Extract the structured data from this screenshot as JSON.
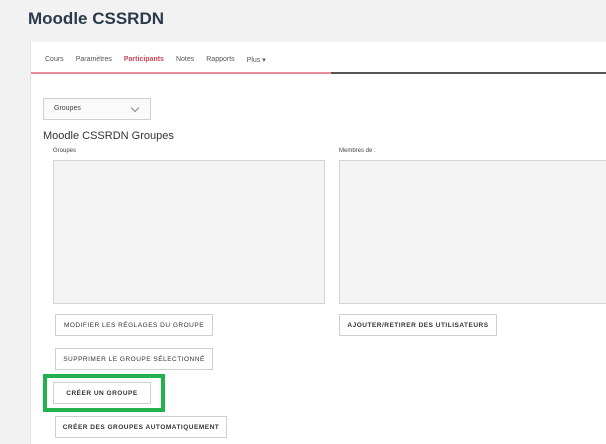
{
  "course": {
    "title": "Moodle CSSRDN"
  },
  "tabs": [
    {
      "label": "Cours"
    },
    {
      "label": "Paramètres"
    },
    {
      "label": "Participants",
      "active": true
    },
    {
      "label": "Notes"
    },
    {
      "label": "Rapports"
    },
    {
      "label": "Plus ▾"
    }
  ],
  "group_select": {
    "value": "Groupes"
  },
  "main": {
    "heading": "Moodle CSSRDN Groupes",
    "groups_label": "Groupes",
    "members_label": "Membres de :"
  },
  "buttons": {
    "edit_group": "MODIFIER LES RÉGLAGES DU GROUPE",
    "add_remove_users": "AJOUTER/RETIRER DES UTILISATEURS",
    "delete_group": "SUPPRIMER LE GROUPE SÉLECTIONNÉ",
    "create_group": "CRÉER UN GROUPE",
    "auto_create_groups": "CRÉER DES GROUPES AUTOMATIQUEMENT"
  },
  "colors": {
    "active_tab": "#c94657",
    "highlight": "#21b24b"
  }
}
